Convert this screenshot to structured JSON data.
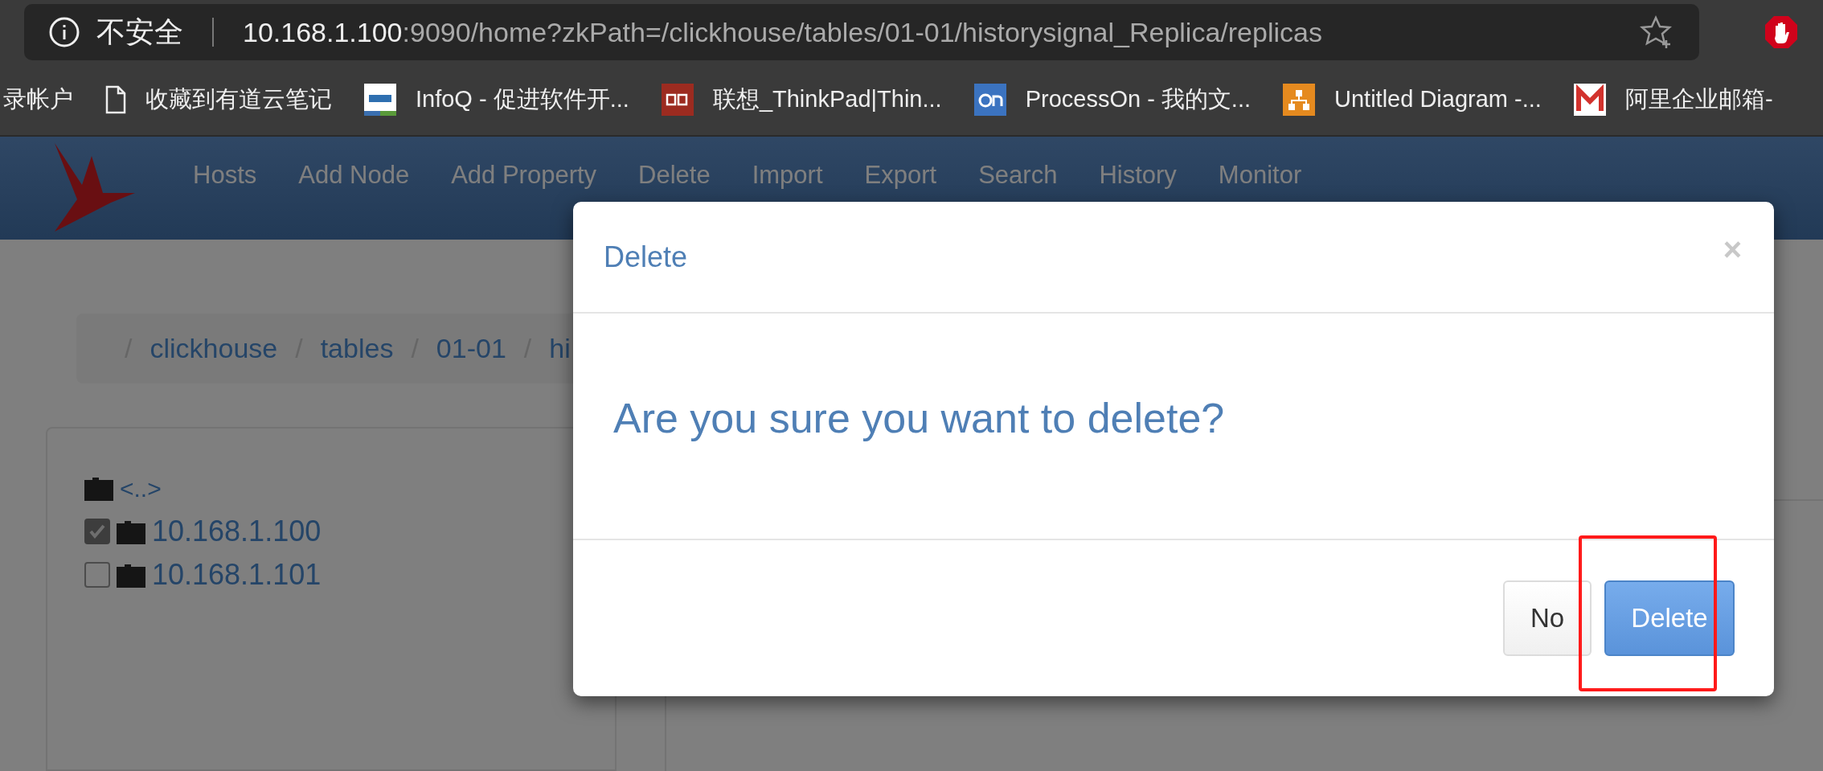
{
  "browser": {
    "security_label": "不安全",
    "address_host": "10.168.1.100",
    "address_rest": ":9090/home?zkPath=/clickhouse/tables/01-01/historysignal_Replica/replicas",
    "bookmarks": [
      {
        "label": "录帐户",
        "kind": "none"
      },
      {
        "label": "收藏到有道云笔记",
        "kind": "page"
      },
      {
        "label": "InfoQ - 促进软件开...",
        "kind": "infoq"
      },
      {
        "label": "联想_ThinkPad|Thin...",
        "kind": "lenovo"
      },
      {
        "label": "ProcessOn - 我的文...",
        "kind": "processon"
      },
      {
        "label": "Untitled Diagram -...",
        "kind": "diagram"
      },
      {
        "label": "阿里企业邮箱-",
        "kind": "mail"
      }
    ]
  },
  "nav": {
    "items": [
      "Hosts",
      "Add Node",
      "Add Property",
      "Delete",
      "Import",
      "Export",
      "Search",
      "History",
      "Monitor"
    ]
  },
  "breadcrumb": [
    {
      "separator": "/",
      "label": "clickhouse"
    },
    {
      "separator": "/",
      "label": "tables"
    },
    {
      "separator": "/",
      "label": "01-01"
    },
    {
      "separator": "/",
      "label": "hi"
    }
  ],
  "tree": [
    {
      "label": "<..>",
      "kind": "parent"
    },
    {
      "label": "10.168.1.100",
      "kind": "node",
      "checked": true
    },
    {
      "label": "10.168.1.101",
      "kind": "node",
      "checked": false
    }
  ],
  "modal": {
    "title": "Delete",
    "close": "×",
    "message": "Are you sure you want to delete?",
    "buttons": [
      {
        "label": "No",
        "kind": "default",
        "highlighted": false
      },
      {
        "label": "Delete",
        "kind": "primary",
        "highlighted": true
      }
    ]
  }
}
